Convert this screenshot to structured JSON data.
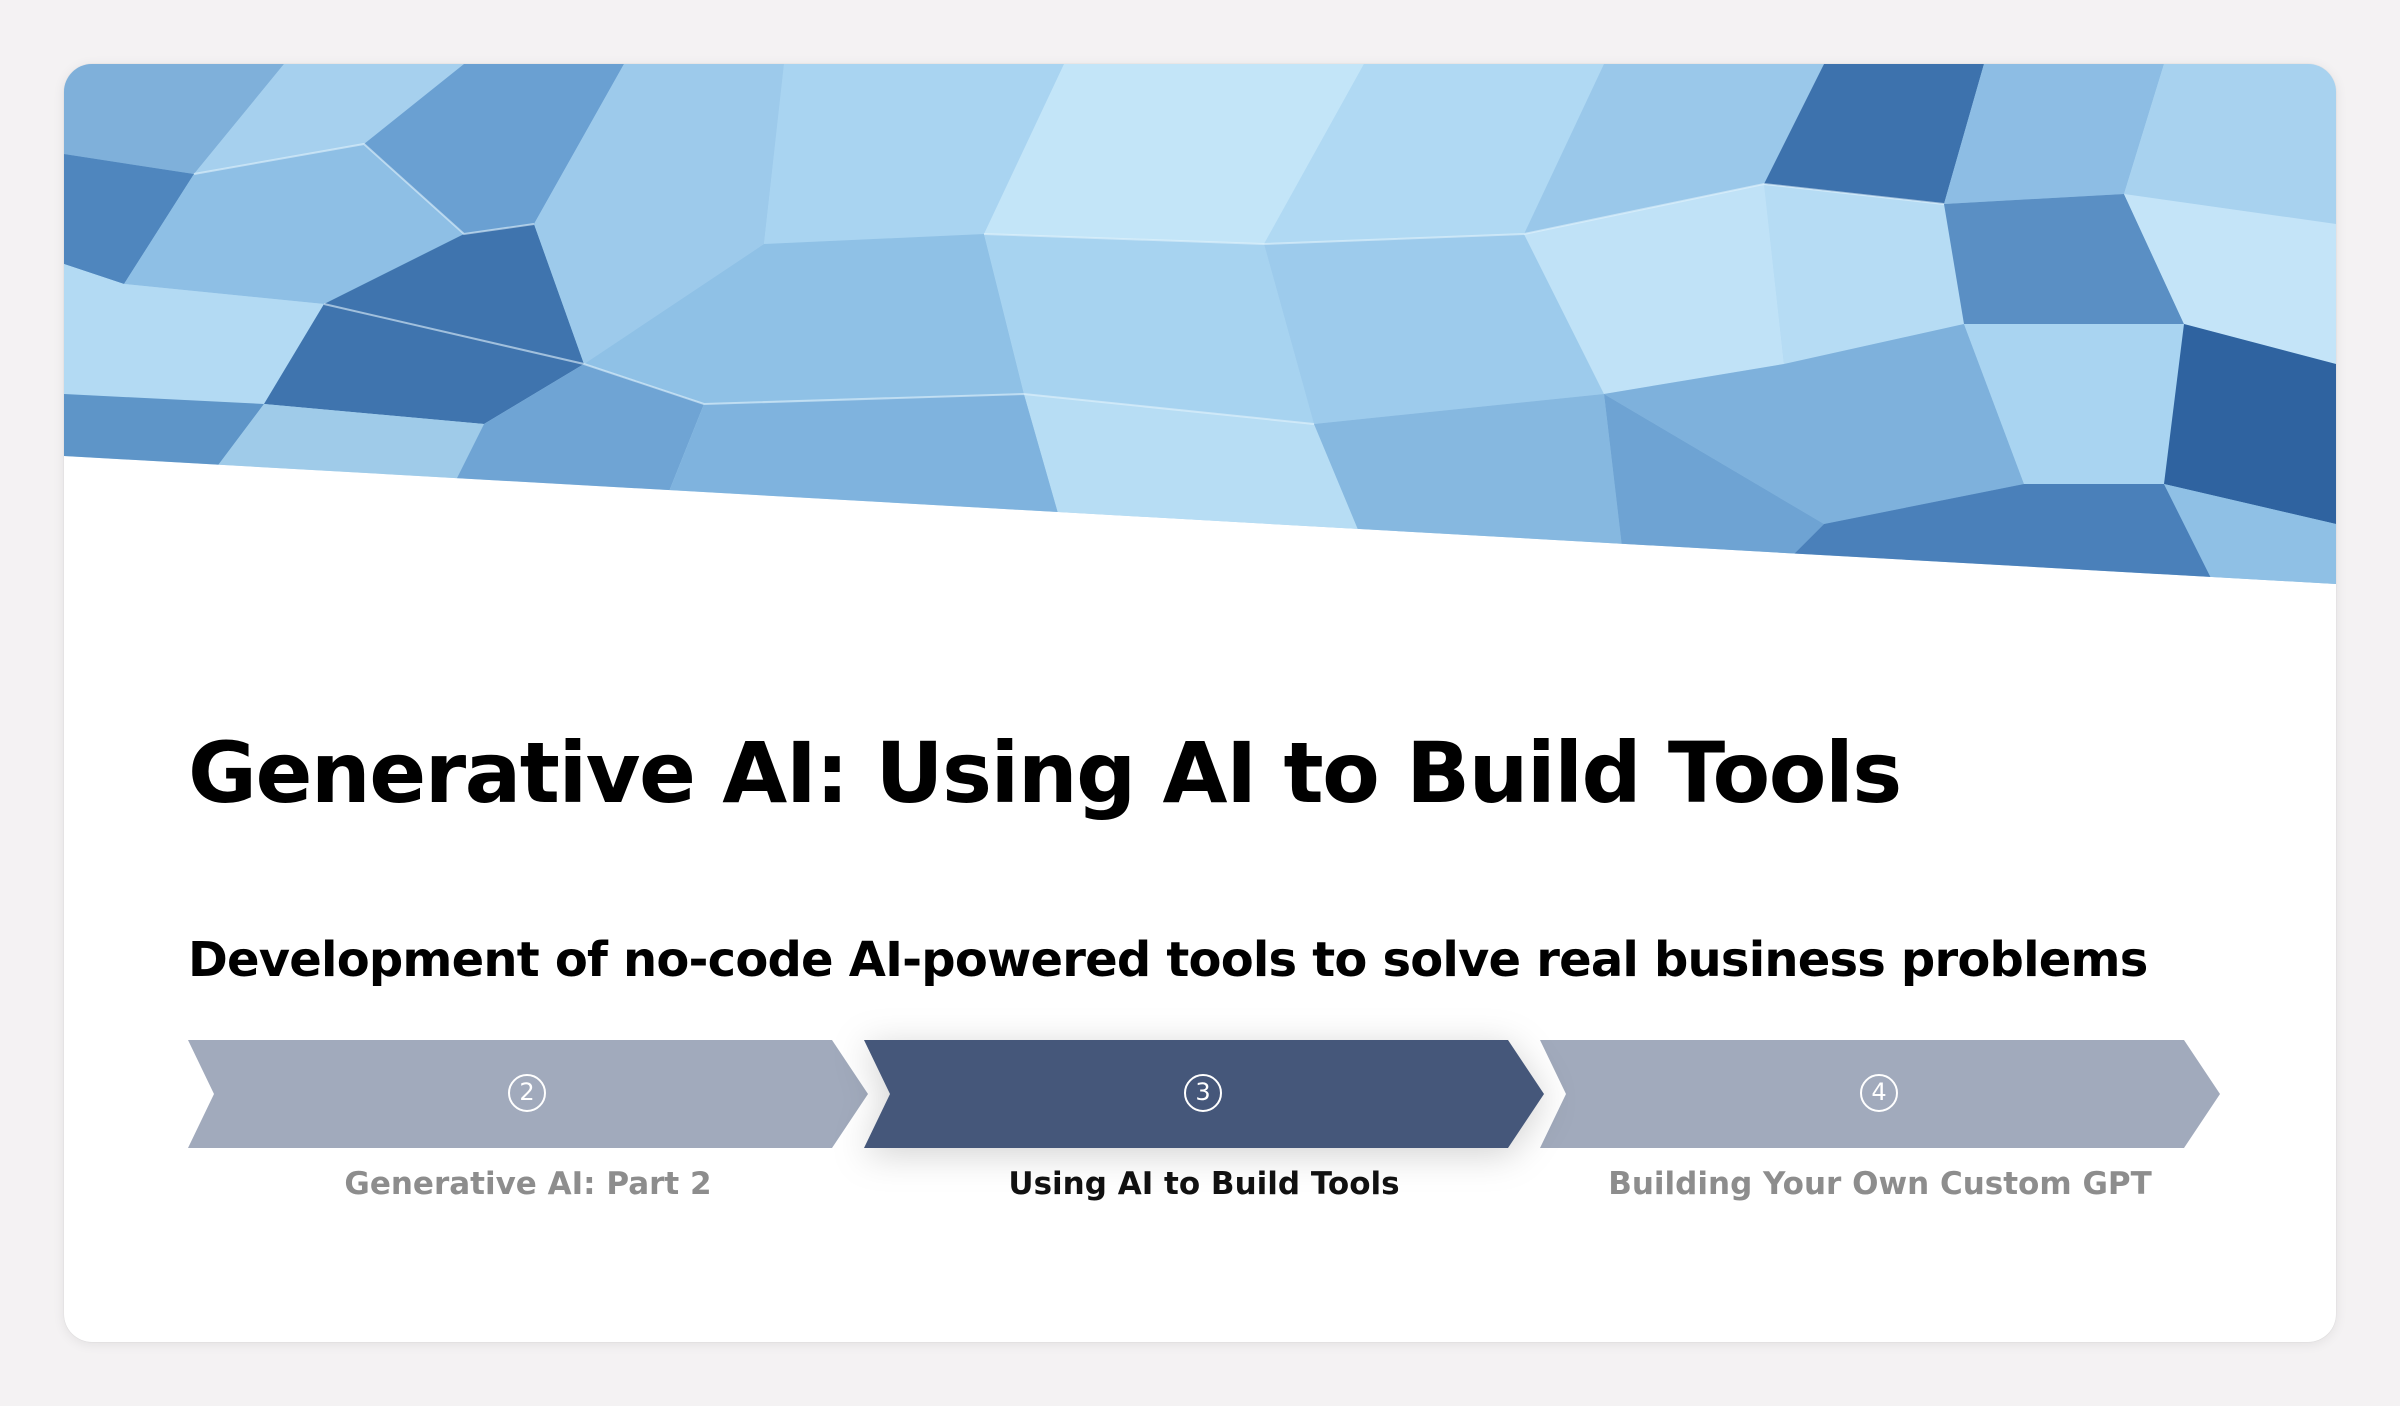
{
  "card": {
    "title": "Generative AI: Using AI to Build Tools",
    "subtitle": "Development of no-code AI-powered tools to solve real business problems"
  },
  "banner": {
    "image": "blue-low-poly-geometric-pattern"
  },
  "steps": [
    {
      "number": "2",
      "label": "Generative AI: Part 2",
      "state": "inactive",
      "color": "#a1aabc"
    },
    {
      "number": "3",
      "label": "Using AI to Build Tools",
      "state": "active",
      "color": "#45577a"
    },
    {
      "number": "4",
      "label": "Building Your Own Custom GPT",
      "state": "inactive",
      "color": "#a1aabc"
    }
  ],
  "colors": {
    "background": "#f4f2f3",
    "card": "#ffffff",
    "active_step": "#45577a",
    "inactive_step": "#a1aabc",
    "inactive_label": "#8d8d8d"
  }
}
